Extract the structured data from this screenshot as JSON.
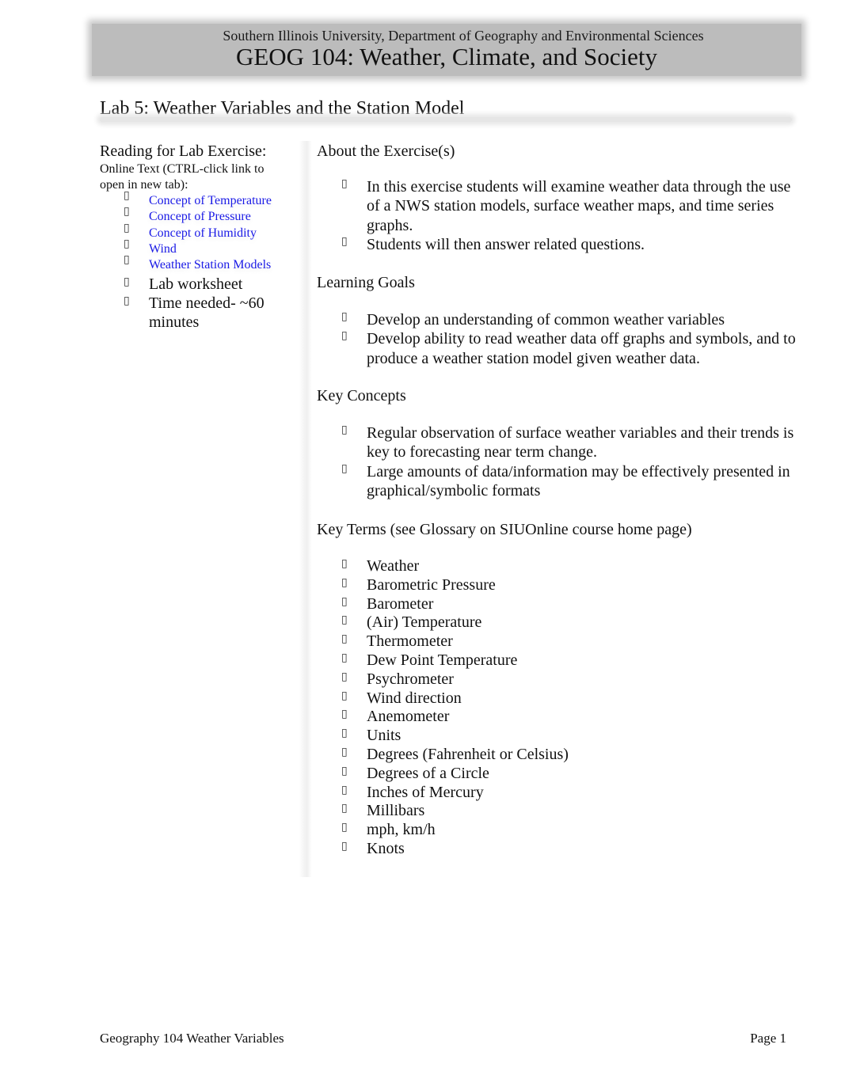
{
  "header": {
    "department": "Southern Illinois University, Department of Geography and Environmental Sciences",
    "course_title": "GEOG 104: Weather, Climate, and Society"
  },
  "lab_title": "Lab 5: Weather Variables and the Station Model",
  "bullet_glyph": "",
  "reading": {
    "heading": "Reading for Lab Exercise:",
    "online_text": "Online Text (CTRL-click link to open in new tab):",
    "links": [
      {
        "label": "Concept of Temperature",
        "icon": "missing-glyph-bullet"
      },
      {
        "label": "Concept of Pressure",
        "icon": "missing-glyph-bullet"
      },
      {
        "label": "Concept of Humidity",
        "icon": "missing-glyph-bullet"
      },
      {
        "label": "Wind",
        "icon": "missing-glyph-bullet"
      },
      {
        "label": "Weather Station Models",
        "icon": "missing-glyph-bullet"
      }
    ],
    "items": [
      "Lab  worksheet",
      "Time needed- ~60 minutes"
    ],
    "link_color": "#1a1ae6"
  },
  "sections": {
    "about": {
      "heading": "About the Exercise(s)",
      "bullets": [
        "In this exercise students will examine weather data through the use of a NWS station models, surface weather maps, and time series graphs.",
        "Students will then answer related questions."
      ]
    },
    "goals": {
      "heading": "Learning Goals",
      "bullets": [
        "Develop an understanding of common weather variables",
        "Develop ability to read weather data off graphs and symbols, and to produce a weather station model given weather data."
      ]
    },
    "concepts": {
      "heading": "Key Concepts",
      "bullets": [
        "Regular observation of surface weather variables and their trends is key to forecasting near term change.",
        "Large amounts of data/information may be effectively presented in graphical/symbolic formats"
      ]
    },
    "terms": {
      "heading": "Key Terms (see Glossary on SIUOnline course home page)",
      "bullets": [
        "Weather",
        "Barometric Pressure",
        "Barometer",
        "(Air) Temperature",
        "Thermometer",
        "Dew Point Temperature",
        "Psychrometer",
        "Wind direction",
        "Anemometer",
        "Units",
        "Degrees (Fahrenheit or Celsius)",
        "Degrees of a Circle",
        "Inches of Mercury",
        "Millibars",
        "mph, km/h",
        "Knots"
      ]
    }
  },
  "footer": {
    "left": "Geography 104 Weather Variables",
    "right": "Page 1"
  }
}
